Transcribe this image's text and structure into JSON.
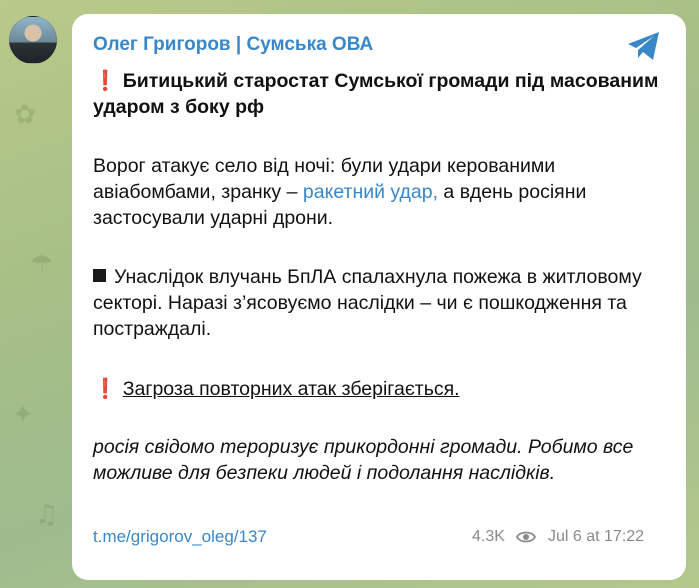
{
  "author": "Олег Григоров | Сумська ОВА",
  "headline": {
    "mark": "❗",
    "text": "Битицький старостат Сумської громади під масованим ударом з боку рф"
  },
  "paragraph1": {
    "before": "Ворог атакує село від ночі: були удари керованими авіабомбами, зранку – ",
    "link": "ракетний удар,",
    "after": " а вдень росіяни застосували ударні дрони."
  },
  "paragraph2": {
    "text": "Унаслідок влучань БпЛА спалахнула пожежа в житловому секторі. Наразі з’ясовуємо наслідки – чи є пошкодження та постраждалі."
  },
  "paragraph3": {
    "mark": "❗",
    "text": "Загроза повторних атак зберігається."
  },
  "paragraph4": {
    "text": "росія свідомо тероризує прикордонні громади. Робимо все можливе для безпеки людей і подолання наслідків."
  },
  "footer": {
    "link": "t.me/grigorov_oleg/137",
    "views": "4.3K",
    "time": "Jul 6 at 17:22"
  },
  "icons": {
    "send": "telegram-send-icon",
    "views": "eye-icon"
  },
  "colors": {
    "accent": "#3a87c7",
    "warning": "#d6232e",
    "meta": "#8a8a8a",
    "background": "#a7bf86"
  }
}
